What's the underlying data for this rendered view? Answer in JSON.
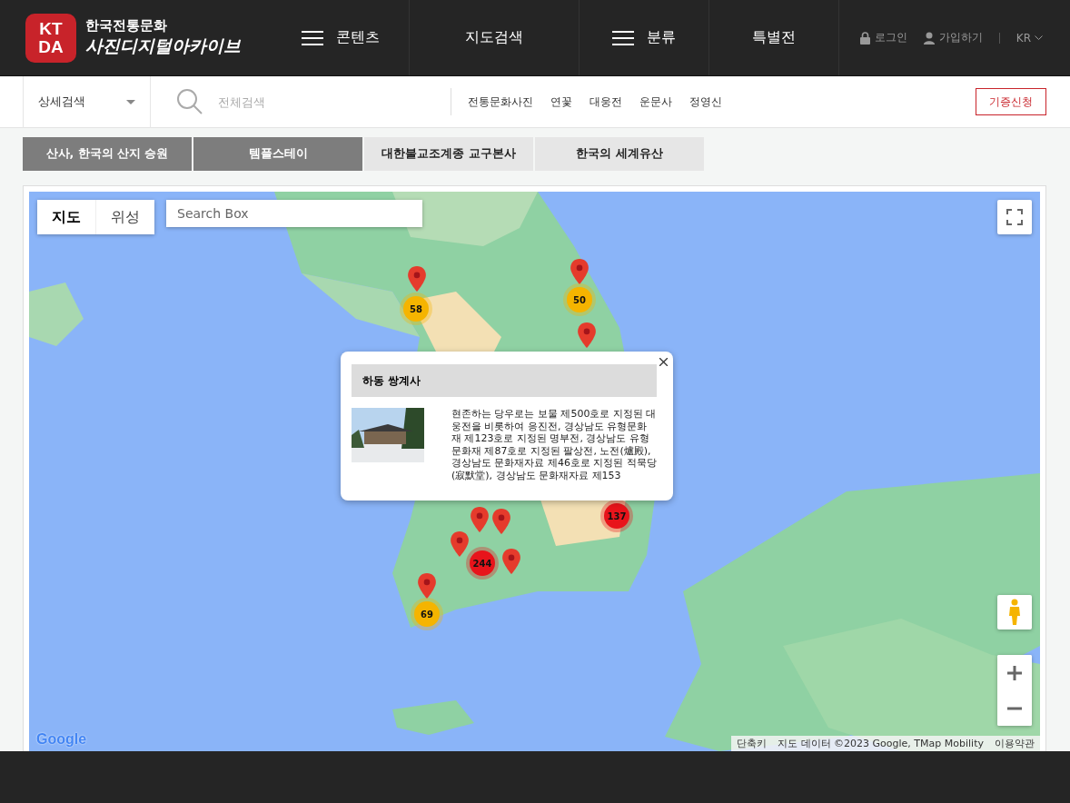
{
  "logo": {
    "mark_top": "KT",
    "mark_bottom": "DA",
    "line_1": "한국전통문화",
    "line_2": "사진디지털아카이브"
  },
  "nav": [
    {
      "label": "콘텐츠",
      "kind": "menu"
    },
    {
      "label": "지도검색",
      "kind": "plain"
    },
    {
      "label": "분류",
      "kind": "menu"
    },
    {
      "label": "특별전",
      "kind": "plain"
    }
  ],
  "user_links": [
    {
      "label": "로그인",
      "kind": "lock"
    },
    {
      "label": "가입하기",
      "kind": "person"
    }
  ],
  "language": "KR",
  "search": {
    "scope": "상세검색",
    "placeholder": "전체검색"
  },
  "keywords": [
    "전통문화사진",
    "연꽃",
    "대웅전",
    "운문사",
    "정영신"
  ],
  "donate_button": "기증신청",
  "tabs": [
    {
      "label": "산사, 한국의 산지 승원",
      "selected": true
    },
    {
      "label": "템플스테이",
      "selected": true
    },
    {
      "label": "대한불교조계종 교구본사",
      "selected": false
    },
    {
      "label": "한국의 세계유산",
      "selected": false
    }
  ],
  "map": {
    "type_buttons": [
      {
        "label": "지도",
        "selected": true
      },
      {
        "label": "위성",
        "selected": false
      }
    ],
    "search_placeholder": "Search Box",
    "clusters": [
      {
        "count": "58",
        "color": "#f5b400"
      },
      {
        "count": "50",
        "color": "#f5b400"
      },
      {
        "count": "137",
        "color": "#e8141b"
      },
      {
        "count": "244",
        "color": "#e8141b"
      },
      {
        "count": "69",
        "color": "#f5b400"
      }
    ],
    "popup": {
      "title": "하동 쌍계사",
      "kind": "picture",
      "text": "현존하는 당우로는 보물 제500호로 지정된 대웅전을 비롯하여 응진전, 경상남도 유형문화재 제123호로 지정된 명부전, 경상남도 유형문화재 제87호로 지정된 팔상전, 노전(爐殿), 경상남도 문화재자료 제46호로 지정된 적묵당(寂默堂), 경상남도 문화재자료 제153"
    },
    "google_logo": "Google",
    "attribution": [
      "단축키",
      "지도 데이터 ©2023 Google, TMap Mobility",
      "이용약관"
    ]
  }
}
